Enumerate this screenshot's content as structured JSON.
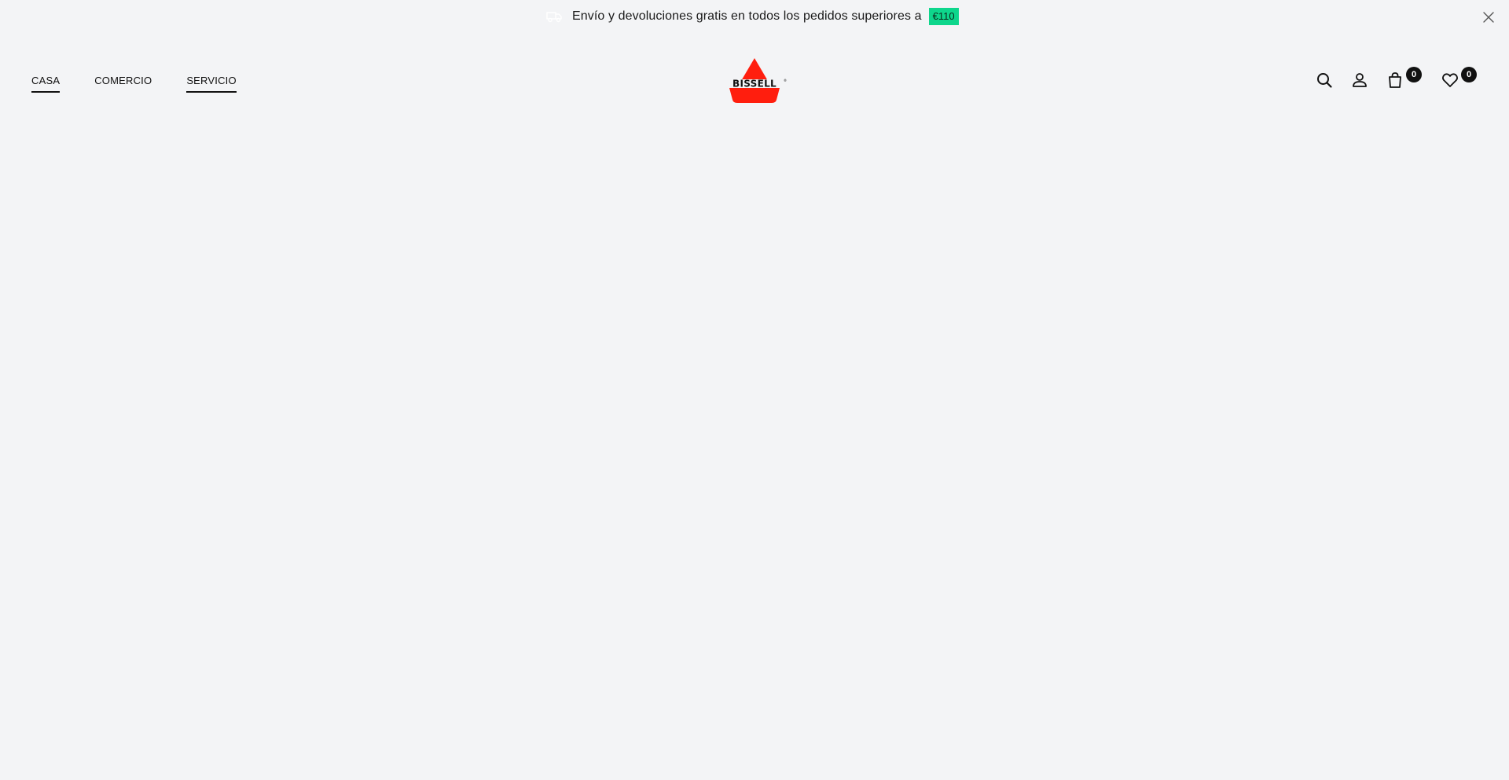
{
  "announcement": {
    "text": "Envío y devoluciones gratis en todos los pedidos superiores a",
    "badge": "€110",
    "truck_icon": "truck-icon",
    "close_icon": "close-icon",
    "badge_color": "#0ed68c"
  },
  "nav": {
    "items": [
      {
        "label": "CASA",
        "active": true
      },
      {
        "label": "COMERCIO",
        "active": false
      },
      {
        "label": "SERVICIO",
        "active": true
      }
    ]
  },
  "logo": {
    "brand": "BISSELL",
    "color": "#ff1e0e"
  },
  "header_actions": {
    "search_icon": "search-icon",
    "account_icon": "user-icon",
    "cart_icon": "shopping-bag-icon",
    "cart_count": "0",
    "wishlist_icon": "heart-icon",
    "wishlist_count": "0"
  },
  "colors": {
    "background": "#f3f4f6",
    "text": "#111111"
  }
}
